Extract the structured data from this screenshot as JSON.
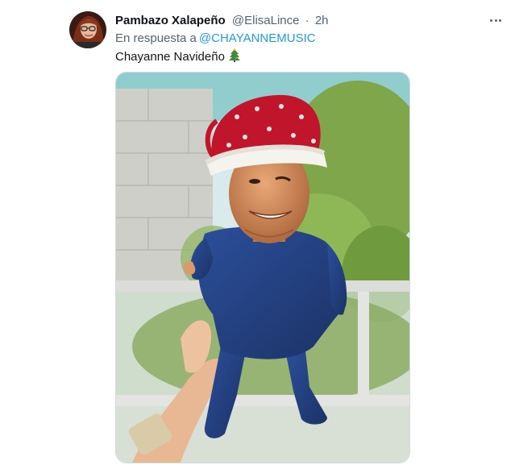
{
  "tweet": {
    "author_name": "Pambazo Xalapeño",
    "author_handle": "@ElisaLince",
    "separator": "·",
    "time": "2h",
    "reply_prefix": "En respuesta a",
    "reply_mention": "@CHAYANNEMUSIC",
    "text": "Chayanne Navideño",
    "emoji_icon": "christmas-tree-icon",
    "more_icon": "more-options-icon"
  },
  "colors": {
    "link": "#1d9bf0",
    "secondary_text": "#536471",
    "primary_text": "#0f1419"
  }
}
